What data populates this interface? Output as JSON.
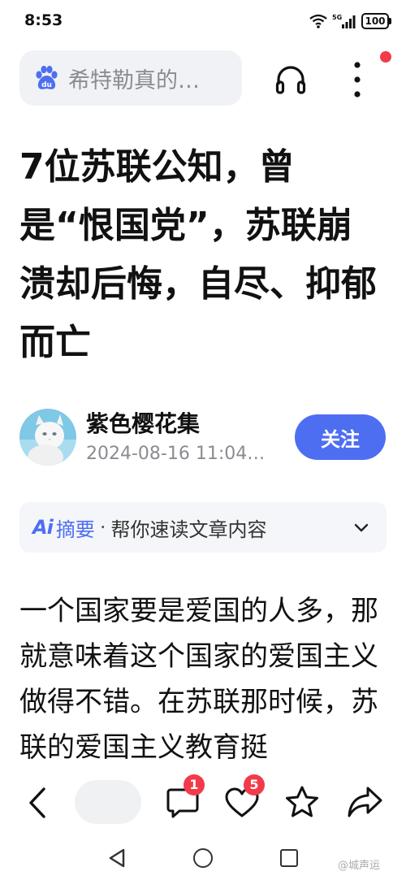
{
  "status": {
    "time": "8:53",
    "network": "5G",
    "battery": "100"
  },
  "header": {
    "search_text": "希特勒真的…",
    "icons": [
      "baidu-paw-icon",
      "headphone-icon",
      "more-vertical-icon"
    ]
  },
  "article": {
    "title": "7位苏联公知，曾是“恨国党”，苏联崩溃却后悔，自尽、抑郁而亡",
    "author": "紫色樱花集",
    "time": "2024-08-16 11:04…",
    "follow_label": "关注",
    "body": "一个国家要是爱国的人多，那就意味着这个国家的爱国主义做得不错。在苏联那时候，苏联的爱国主义教育挺"
  },
  "ai_summary": {
    "logo": "Ai",
    "label": "摘要",
    "separator": "·",
    "description": "帮你速读文章内容"
  },
  "bottom_bar": {
    "comment_count": "1",
    "like_count": "5"
  },
  "watermark": "@城声运",
  "colors": {
    "accent": "#4e6ef2",
    "badge": "#f23b4a",
    "search_bg": "#f1f2f5"
  }
}
